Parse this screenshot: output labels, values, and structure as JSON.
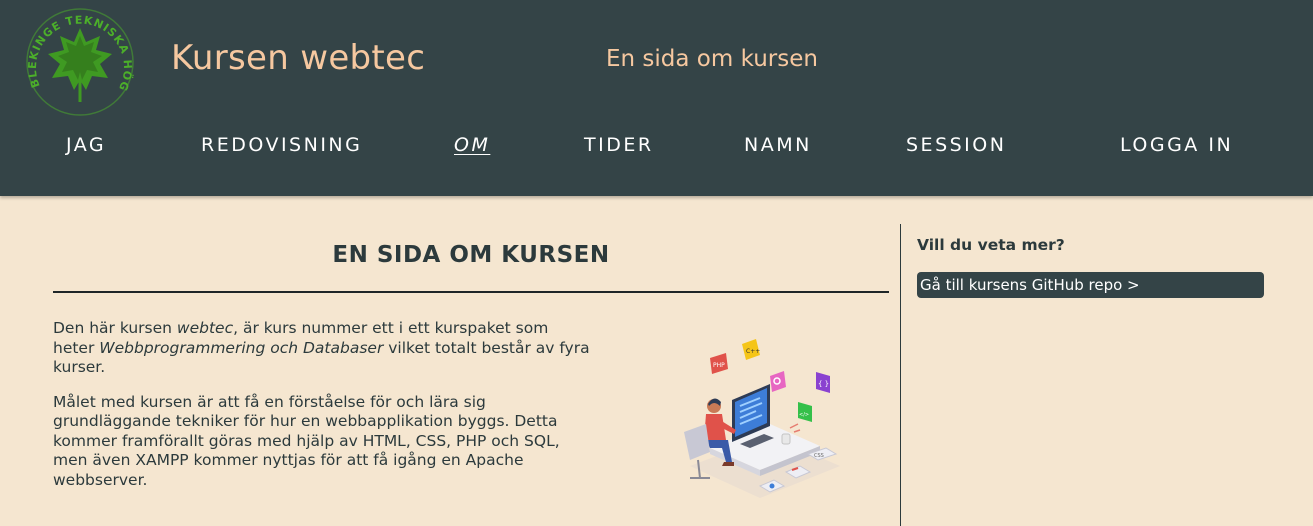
{
  "header": {
    "logo_text": "BLEKINGE TEKNISKA HÖGSKOLA · BTH",
    "site_title": "Kursen webtec",
    "slogan": "En sida om kursen"
  },
  "nav": {
    "items": [
      {
        "label": "JAG"
      },
      {
        "label": "REDOVISNING"
      },
      {
        "label": "OM",
        "active": true
      },
      {
        "label": "TIDER"
      },
      {
        "label": "NAMN"
      },
      {
        "label": "SESSION"
      },
      {
        "label": "LOGGA IN"
      }
    ]
  },
  "main": {
    "heading": "EN SIDA OM KURSEN",
    "paragraph1": {
      "before": "Den här kursen ",
      "course": "webtec",
      "middle": ", är kurs nummer ett i ett kurspaket som heter ",
      "package": "Webbprogrammering och Databaser",
      "after": " vilket totalt består av fyra kurser."
    },
    "paragraph2": "Målet med kursen är att få en förståelse för och lära sig grundläggande tekniker för hur en webbapplikation byggs. Detta kommer framförallt göras med hjälp av HTML, CSS, PHP och SQL, men även XAMPP kommer nyttjas för att få igång en Apache webbserver.",
    "illustration": {
      "icon_labels": [
        "C++",
        "PHP",
        "{ }",
        "</>",
        "CSS"
      ]
    }
  },
  "sidebar": {
    "heading": "Vill du veta mer?",
    "repo_link": "Gå till kursens GitHub repo >"
  },
  "colors": {
    "header_bg": "#344447",
    "page_bg": "#f5e6d0",
    "title_accent": "#f6c8a0",
    "logo_green": "#4caf2a"
  }
}
